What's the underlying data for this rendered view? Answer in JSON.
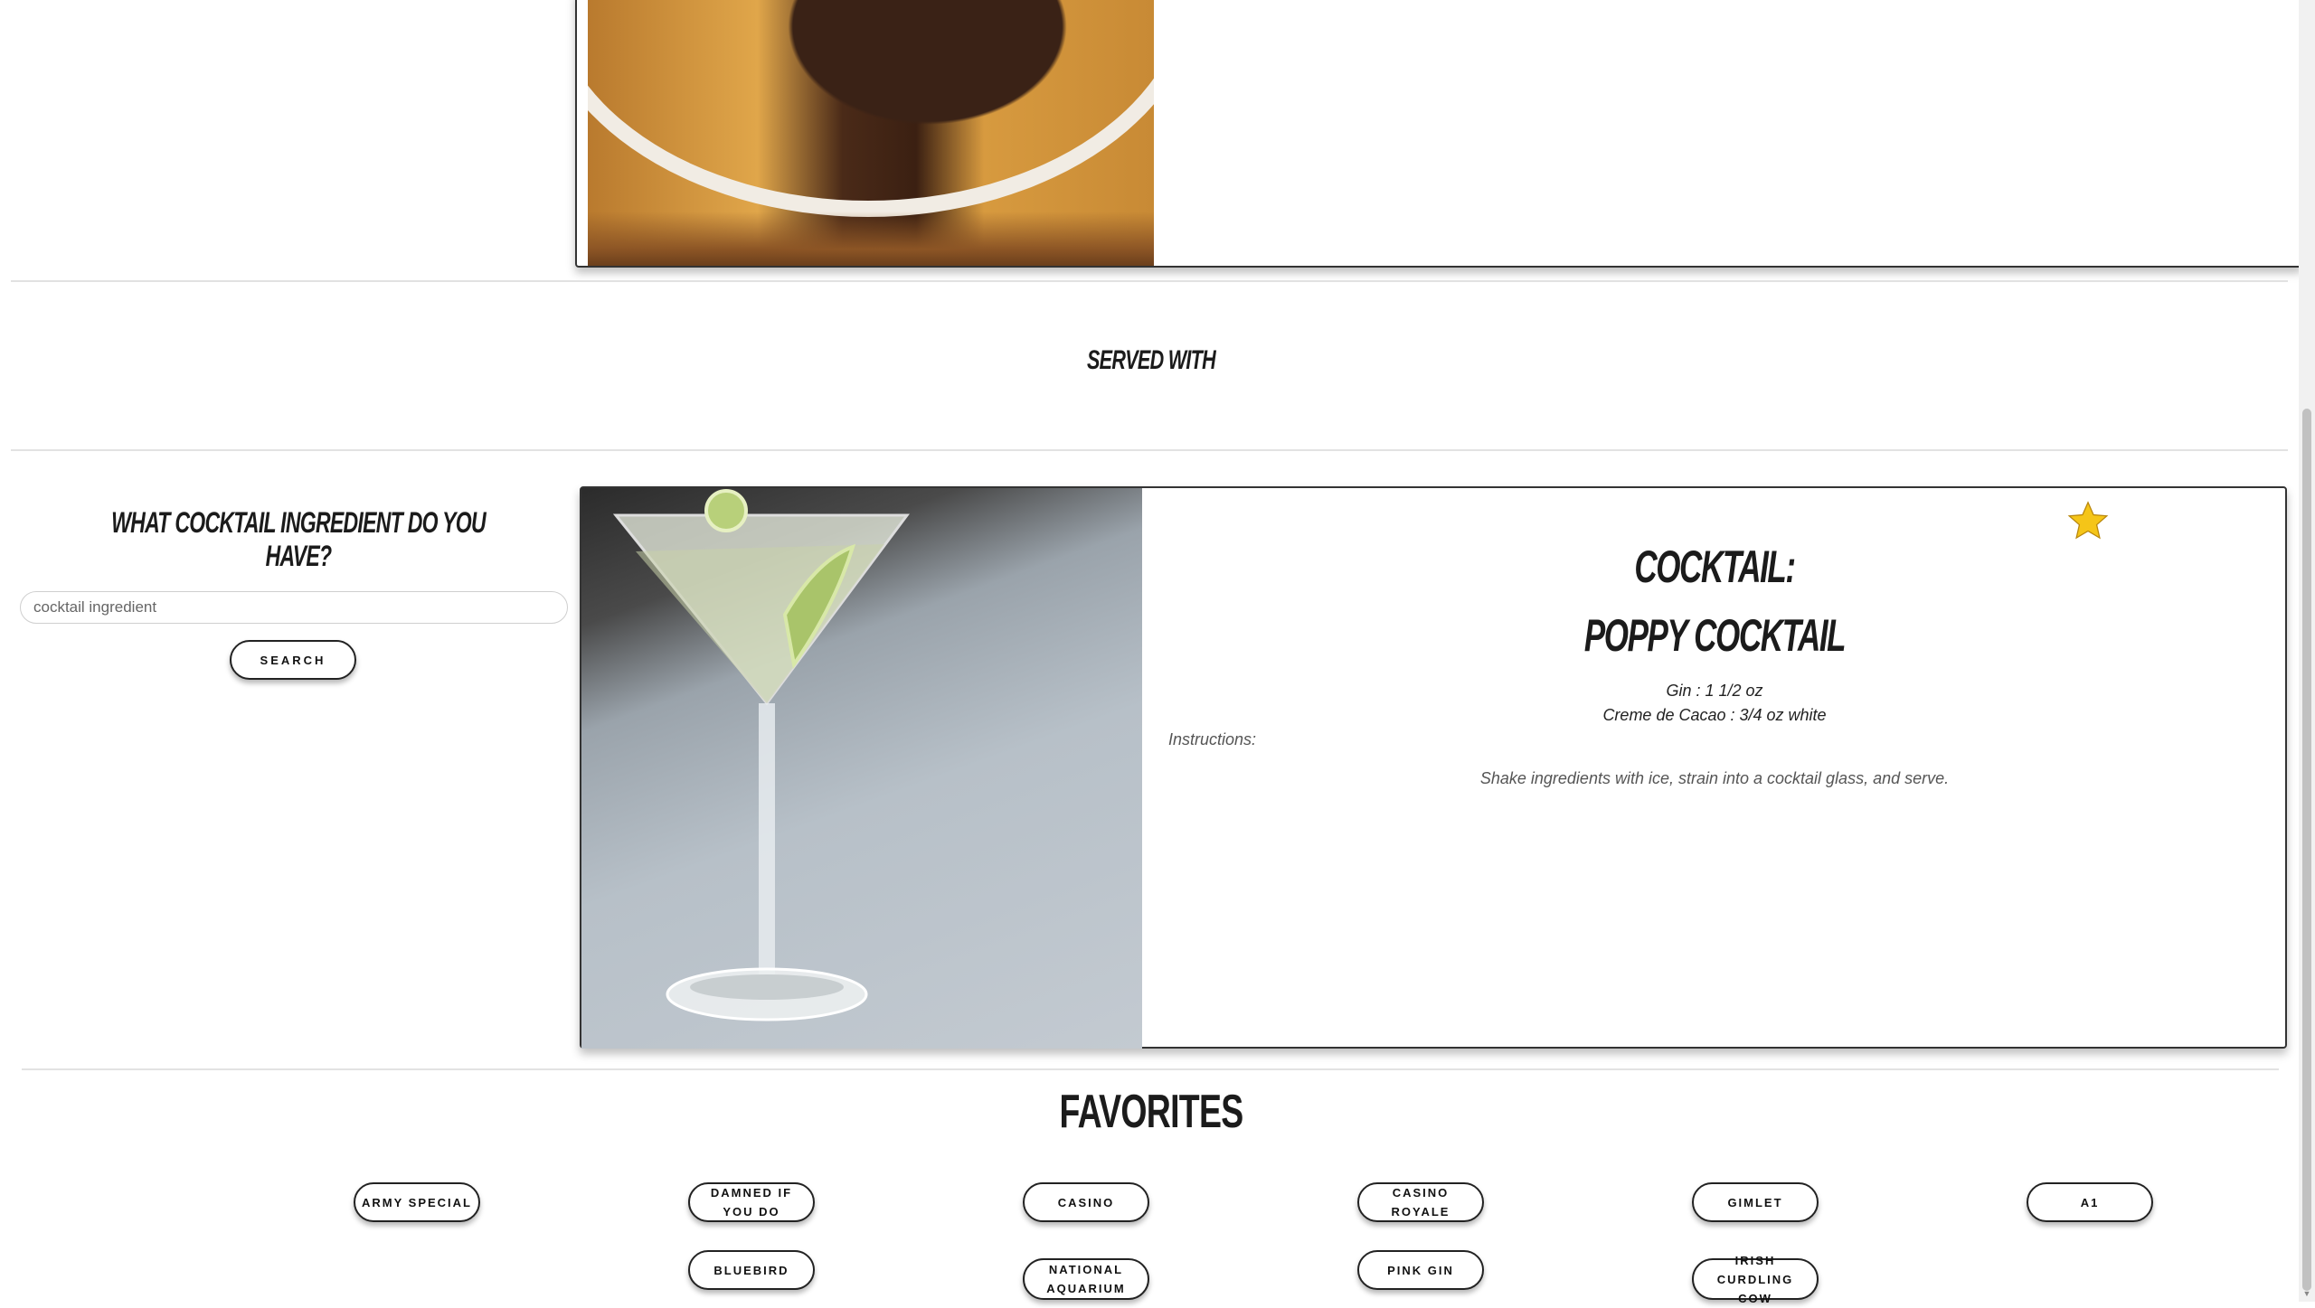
{
  "served_with": {
    "heading": "SERVED WITH"
  },
  "ingredient_search": {
    "title": "WHAT COCKTAIL INGREDIENT DO YOU HAVE?",
    "placeholder": "cocktail ingredient",
    "value": "",
    "button_label": "SEARCH"
  },
  "cocktail": {
    "label": "COCKTAIL:",
    "name": "POPPY COCKTAIL",
    "favorite_icon": "star-icon",
    "favorite_color": "#F5C518",
    "ingredients": [
      "Gin : 1 1/2 oz",
      "Creme de Cacao : 3/4 oz white"
    ],
    "instructions_label": "Instructions:",
    "instructions": "Shake ingredients with ice, strain into a cocktail glass, and serve."
  },
  "favorites": {
    "title": "FAVORITES",
    "items": [
      "ARMY SPECIAL",
      "DAMNED IF YOU DO",
      "CASINO",
      "CASINO ROYALE",
      "GIMLET",
      "A1",
      "BLUEBIRD",
      "NATIONAL AQUARIUM",
      "PINK GIN",
      "IRISH CURDLING COW"
    ]
  }
}
